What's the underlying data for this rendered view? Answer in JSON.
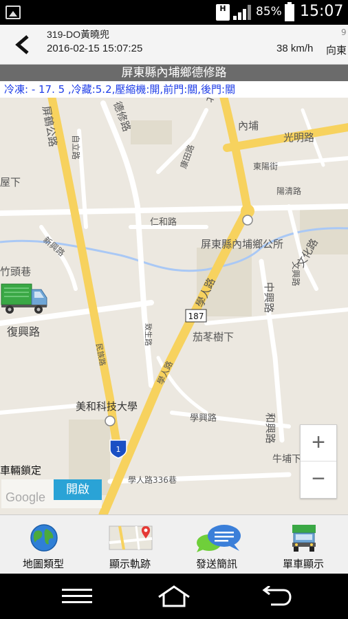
{
  "status_bar": {
    "network_badge": "H",
    "battery_percent": "85%",
    "time": "15:07"
  },
  "header": {
    "vehicle": "319-DO黃曉兜",
    "timestamp": "2016-02-15  15:07:25",
    "speed": "38 km/h",
    "direction": "向東",
    "corner_digit": "9"
  },
  "address": "屏東縣內埔鄉德修路",
  "sensor_line": "冷凍: - 17. 5 ,冷藏:5.2,壓縮機:開,前門:關,後門:關",
  "map": {
    "labels": {
      "pingjian_road": "屏鶴公路",
      "deyi_road": "德修路",
      "beining_road": "北寧路",
      "neipu": "內埔",
      "guangming_road": "光明路",
      "zili_road": "自立路",
      "kangtian_road": "康田路",
      "dongyang_st": "東陽街",
      "yangqing_road": "陽清路",
      "renhe_road": "仁和路",
      "township_office": "屏東縣內埔鄉公所",
      "wenhua_road": "文化路",
      "wenxing_road": "文興路",
      "xinxing_road": "新興路",
      "zhongxing_road": "中興路",
      "xiaxia": "屋下",
      "zhutou": "竹頭巷",
      "route_187": "187",
      "xueren_road": "學人路",
      "jiaodong": "茄苳樹下",
      "fuxing_road": "復興路",
      "jianmei_road": "民族路",
      "zhisheng_road": "致生路",
      "meihe_univ": "美和科技大學",
      "route_1": "1",
      "xuexing_road": "學興路",
      "hejing_road": "和興路",
      "niu_qiao": "牛埔下",
      "xueren_336": "學人路336巷"
    }
  },
  "controls": {
    "lock_label": "車輛鎖定",
    "lock_button": "開啟",
    "zoom_in": "+",
    "zoom_out": "−",
    "google": "Google"
  },
  "toolbar": [
    {
      "label": "地圖類型",
      "icon": "globe-icon"
    },
    {
      "label": "顯示軌跡",
      "icon": "map-track-icon"
    },
    {
      "label": "發送簡訊",
      "icon": "chat-bubble-icon"
    },
    {
      "label": "單車顯示",
      "icon": "truck-front-icon"
    }
  ],
  "colors": {
    "major_road": "#f7d25e",
    "address_bar": "#6b6b6b",
    "sensor_text": "#1e3de8",
    "lock_button": "#2aa3d6"
  }
}
